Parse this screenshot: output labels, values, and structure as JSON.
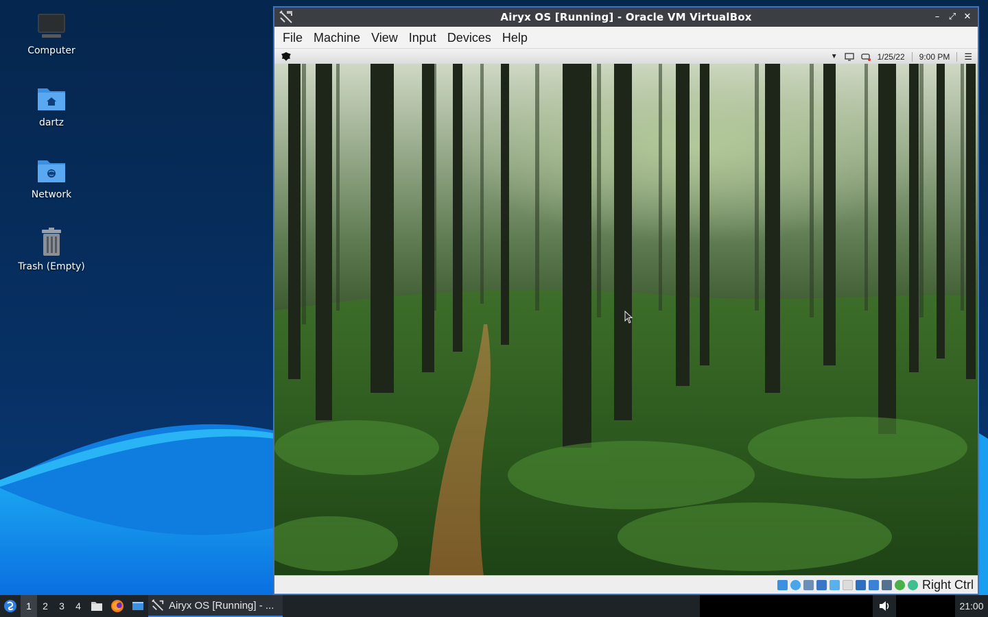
{
  "desktop": {
    "icons": [
      {
        "label": "Computer",
        "icon": "computer-icon"
      },
      {
        "label": "dartz",
        "icon": "home-folder-icon"
      },
      {
        "label": "Network",
        "icon": "network-folder-icon"
      },
      {
        "label": "Trash (Empty)",
        "icon": "trash-icon"
      }
    ]
  },
  "window": {
    "title": "Airyx OS [Running] - Oracle VM VirtualBox",
    "app_icon": "virtualbox-icon",
    "controls": [
      "minimize-icon",
      "maximize-icon",
      "close-icon"
    ],
    "menu": [
      "File",
      "Machine",
      "View",
      "Input",
      "Devices",
      "Help"
    ]
  },
  "guest": {
    "panel": {
      "logo": "airyx-logo-icon",
      "date": "1/25/22",
      "time": "9:00 PM"
    },
    "wallpaper": "forest path"
  },
  "statusbar": {
    "host_key": "Right Ctrl",
    "icons": [
      "hard-disk-icon",
      "optical-drive-icon",
      "audio-icon",
      "network-icon",
      "usb-icon",
      "shared-folders-icon",
      "display-icon",
      "recording-icon",
      "guest-additions-icon",
      "cpu-icon",
      "mouse-integration-icon"
    ]
  },
  "taskbar": {
    "workspaces": [
      "1",
      "2",
      "3",
      "4"
    ],
    "active_workspace": "1",
    "task_label": "Airyx OS [Running] - ...",
    "clock": "21:00",
    "colors": {
      "accent": "#3c82d8",
      "panel": "#1e2327"
    }
  }
}
